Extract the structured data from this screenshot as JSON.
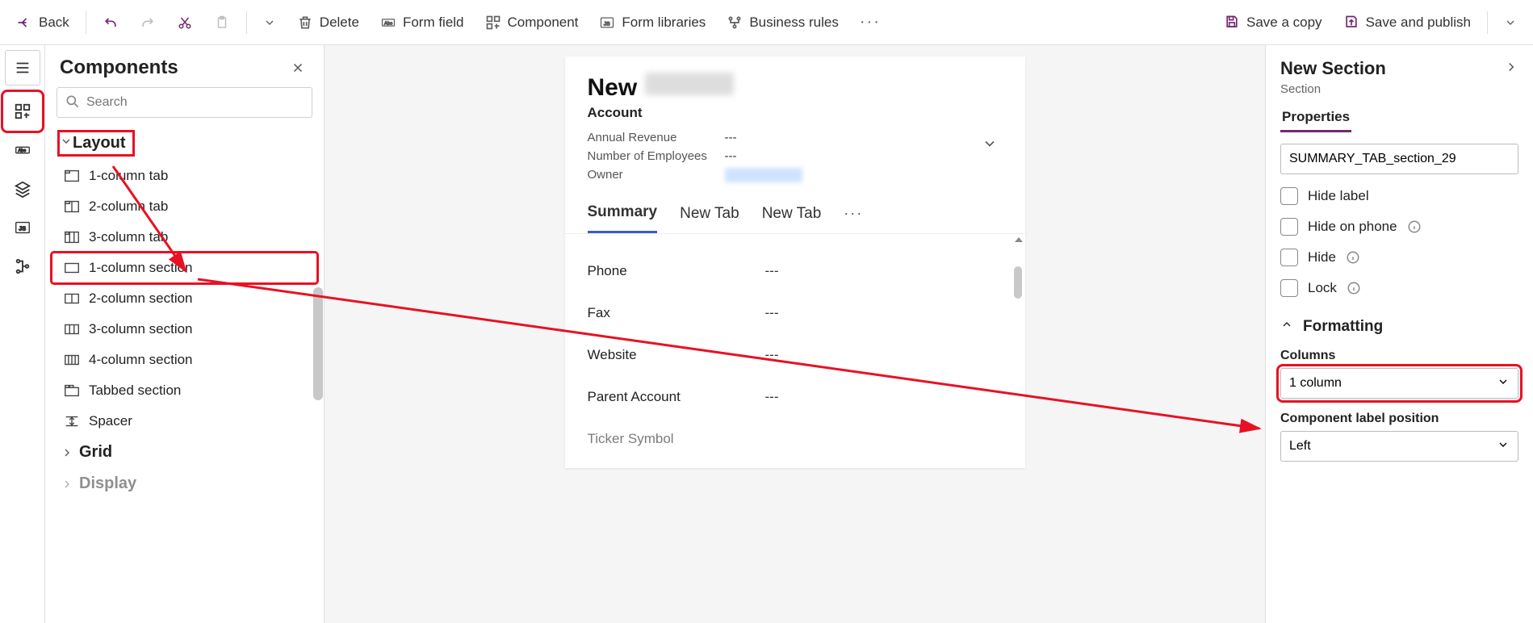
{
  "toolbar": {
    "back": "Back",
    "delete": "Delete",
    "form_field": "Form field",
    "component": "Component",
    "form_libraries": "Form libraries",
    "business_rules": "Business rules",
    "save_copy": "Save a copy",
    "save_publish": "Save and publish"
  },
  "components_panel": {
    "title": "Components",
    "search_placeholder": "Search",
    "groups": {
      "layout": {
        "label": "Layout",
        "items": [
          "1-column tab",
          "2-column tab",
          "3-column tab",
          "1-column section",
          "2-column section",
          "3-column section",
          "4-column section",
          "Tabbed section",
          "Spacer"
        ]
      },
      "grid": {
        "label": "Grid"
      },
      "display": {
        "label": "Display"
      }
    }
  },
  "form": {
    "name": "New",
    "entity": "Account",
    "meta": {
      "annual_revenue": {
        "label": "Annual Revenue",
        "value": "---"
      },
      "employees": {
        "label": "Number of Employees",
        "value": "---"
      },
      "owner": {
        "label": "Owner"
      }
    },
    "tabs": [
      "Summary",
      "New Tab",
      "New Tab"
    ],
    "active_tab": 0,
    "fields": [
      {
        "label": "Phone",
        "value": "---"
      },
      {
        "label": "Fax",
        "value": "---"
      },
      {
        "label": "Website",
        "value": "---"
      },
      {
        "label": "Parent Account",
        "value": "---"
      },
      {
        "label": "Ticker Symbol",
        "value": ""
      }
    ]
  },
  "props": {
    "title": "New Section",
    "subtitle": "Section",
    "tab": "Properties",
    "name_value": "SUMMARY_TAB_section_29",
    "hide_label": "Hide label",
    "hide_phone": "Hide on phone",
    "hide": "Hide",
    "lock": "Lock",
    "formatting": "Formatting",
    "columns_label": "Columns",
    "columns_value": "1 column",
    "label_pos_label": "Component label position",
    "label_pos_value": "Left"
  }
}
